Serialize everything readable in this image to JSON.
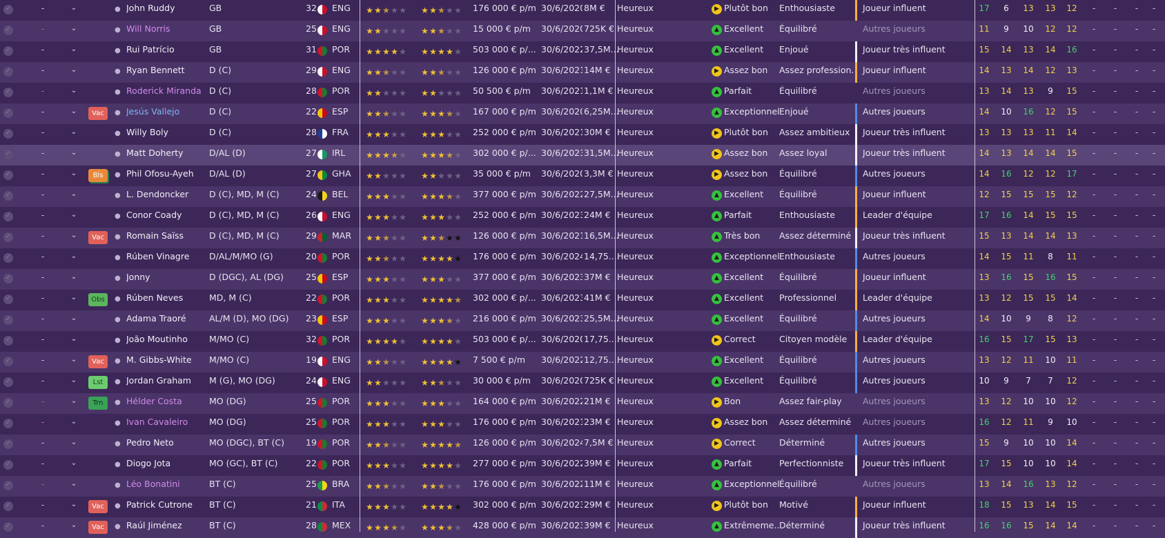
{
  "colors": {
    "positive": "#35c13e",
    "warning": "#f0c419",
    "loan": "#d28be9"
  },
  "rows": [
    {
      "name": "John Ruddy",
      "pos": "GB",
      "age": "32",
      "nat": "ENG",
      "cur": "2.5",
      "pot": "2.5",
      "wage": "176 000 € p/m",
      "exp": "30/6/2020",
      "val": "8M €",
      "happy": "Heureux",
      "cond_icon": "yellow",
      "cond": "Plutôt bon",
      "pers": "Enthousiaste",
      "status": "Joueur influent",
      "status_color": "yellow",
      "attrs": [
        "17",
        "6",
        "13",
        "13",
        "12"
      ]
    },
    {
      "name": "Will Norris",
      "pos": "GB",
      "age": "25",
      "nat": "ENG",
      "cur": "2",
      "pot": "2.5",
      "wage": "15 000 € p/m",
      "exp": "30/6/2020",
      "val": "725K €",
      "happy": "Heureux",
      "cond_icon": "green",
      "cond": "Excellent",
      "pers": "Équilibré",
      "status": "Autres joueurs",
      "status_color": "none",
      "attrs": [
        "11",
        "9",
        "10",
        "12",
        "12"
      ]
    },
    {
      "name": "Rui Patrício",
      "pos": "GB",
      "age": "31",
      "nat": "POR",
      "cur": "4",
      "pot": "4",
      "wage": "503 000 € p/...",
      "exp": "30/6/2022",
      "val": "37,5M...",
      "happy": "Heureux",
      "cond_icon": "green",
      "cond": "Excellent",
      "pers": "Enjoué",
      "status": "Joueur très influent",
      "status_color": "white",
      "attrs": [
        "15",
        "14",
        "13",
        "14",
        "16"
      ]
    },
    {
      "name": "Ryan Bennett",
      "pos": "D (C)",
      "age": "29",
      "nat": "ENG",
      "cur": "2.5",
      "pot": "2.5",
      "wage": "126 000 € p/m",
      "exp": "30/6/2021",
      "val": "14M €",
      "happy": "Heureux",
      "cond_icon": "yellow",
      "cond": "Assez bon",
      "pers": "Assez profession...",
      "status": "Joueur influent",
      "status_color": "yellow",
      "attrs": [
        "14",
        "13",
        "14",
        "12",
        "13"
      ]
    },
    {
      "name": "Roderick Miranda",
      "pos": "D (C)",
      "age": "28",
      "nat": "POR",
      "cur": "2",
      "pot": "2",
      "wage": "50 500 € p/m",
      "exp": "30/6/2021",
      "val": "1,1M €",
      "happy": "Heureux",
      "cond_icon": "green",
      "cond": "Parfait",
      "pers": "Équilibré",
      "status": "Autres joueurs",
      "status_color": "none",
      "attrs": [
        "13",
        "14",
        "13",
        "9",
        "15"
      ]
    },
    {
      "name": "Jesús Vallejo",
      "pos": "D (C)",
      "age": "22",
      "nat": "ESP",
      "cur": "2.5",
      "pot": "3.5",
      "wage": "167 000 € p/m",
      "exp": "30/6/2020",
      "val": "6,25M...",
      "happy": "Heureux",
      "cond_icon": "green",
      "cond": "Exceptionnel",
      "pers": "Enjoué",
      "status": "Autres joueurs",
      "status_color": "blue",
      "attrs": [
        "14",
        "10",
        "16",
        "12",
        "15"
      ]
    },
    {
      "name": "Willy Boly",
      "pos": "D (C)",
      "age": "28",
      "nat": "FRA",
      "cur": "3",
      "pot": "3",
      "wage": "252 000 € p/m",
      "exp": "30/6/2021",
      "val": "30M €",
      "happy": "Heureux",
      "cond_icon": "yellow",
      "cond": "Plutôt bon",
      "pers": "Assez ambitieux",
      "status": "Joueur très influent",
      "status_color": "white",
      "attrs": [
        "13",
        "13",
        "13",
        "11",
        "14"
      ]
    },
    {
      "name": "Matt Doherty",
      "pos": "D/AL (D)",
      "age": "27",
      "nat": "IRL",
      "cur": "3.5",
      "pot": "3.5",
      "wage": "302 000 € p/...",
      "exp": "30/6/2023",
      "val": "31,5M...",
      "happy": "Heureux",
      "cond_icon": "yellow",
      "cond": "Assez bon",
      "pers": "Assez loyal",
      "status": "Joueur très influent",
      "status_color": "white",
      "attrs": [
        "14",
        "13",
        "14",
        "14",
        "15"
      ]
    },
    {
      "name": "Phil Ofosu-Ayeh",
      "pos": "D/AL (D)",
      "age": "27",
      "nat": "GHA",
      "cur": "2",
      "pot": "2",
      "wage": "35 000 € p/m",
      "exp": "30/6/2020",
      "val": "3,3M €",
      "happy": "Heureux",
      "cond_icon": "yellow",
      "cond": "Assez bon",
      "pers": "Équilibré",
      "status": "Autres joueurs",
      "status_color": "blue",
      "attrs": [
        "14",
        "16",
        "12",
        "12",
        "17"
      ]
    },
    {
      "name": "L. Dendoncker",
      "pos": "D (C), MD, M (C)",
      "age": "24",
      "nat": "BEL",
      "cur": "3",
      "pot": "3.5",
      "wage": "377 000 € p/m",
      "exp": "30/6/2022",
      "val": "27,5M...",
      "happy": "Heureux",
      "cond_icon": "green",
      "cond": "Excellent",
      "pers": "Équilibré",
      "status": "Joueur influent",
      "status_color": "yellow",
      "attrs": [
        "12",
        "15",
        "15",
        "15",
        "12"
      ]
    },
    {
      "name": "Conor Coady",
      "pos": "D (C), MD, M (C)",
      "age": "26",
      "nat": "ENG",
      "cur": "3",
      "pot": "3",
      "wage": "252 000 € p/m",
      "exp": "30/6/2023",
      "val": "24M €",
      "happy": "Heureux",
      "cond_icon": "green",
      "cond": "Parfait",
      "pers": "Enthousiaste",
      "status": "Leader d'équipe",
      "status_color": "yellow",
      "attrs": [
        "17",
        "16",
        "14",
        "15",
        "15"
      ]
    },
    {
      "name": "Romain Saïss",
      "pos": "D (C), MD, M (C)",
      "age": "29",
      "nat": "MAR",
      "cur": "2.5",
      "pot": "2.5",
      "wage": "126 000 € p/m",
      "exp": "30/6/2021",
      "val": "16,5M...",
      "happy": "Heureux",
      "cond_icon": "green",
      "cond": "Très bon",
      "pers": "Assez déterminé",
      "status": "Joueur très influent",
      "status_color": "white",
      "attrs": [
        "15",
        "13",
        "14",
        "14",
        "13"
      ]
    },
    {
      "name": "Rúben Vinagre",
      "pos": "D/AL/M/MO (G)",
      "age": "20",
      "nat": "POR",
      "cur": "2.5",
      "pot": "4",
      "wage": "176 000 € p/m",
      "exp": "30/6/2024",
      "val": "14,75....",
      "happy": "Heureux",
      "cond_icon": "green",
      "cond": "Exceptionnel",
      "pers": "Enthousiaste",
      "status": "Autres joueurs",
      "status_color": "blue",
      "attrs": [
        "14",
        "15",
        "11",
        "8",
        "11"
      ]
    },
    {
      "name": "Jonny",
      "pos": "D (DGC), AL (DG)",
      "age": "25",
      "nat": "ESP",
      "cur": "3",
      "pot": "3",
      "wage": "377 000 € p/m",
      "exp": "30/6/2023",
      "val": "37M €",
      "happy": "Heureux",
      "cond_icon": "green",
      "cond": "Excellent",
      "pers": "Équilibré",
      "status": "Joueur influent",
      "status_color": "yellow",
      "attrs": [
        "13",
        "16",
        "15",
        "16",
        "15"
      ]
    },
    {
      "name": "Rúben Neves",
      "pos": "MD, M (C)",
      "age": "22",
      "nat": "POR",
      "cur": "3",
      "pot": "4.5",
      "wage": "302 000 € p/...",
      "exp": "30/6/2023",
      "val": "41M €",
      "happy": "Heureux",
      "cond_icon": "green",
      "cond": "Excellent",
      "pers": "Professionnel",
      "status": "Leader d'équipe",
      "status_color": "yellow",
      "attrs": [
        "13",
        "12",
        "15",
        "15",
        "14"
      ]
    },
    {
      "name": "Adama Traoré",
      "pos": "AL/M (D), MO (DG)",
      "age": "23",
      "nat": "ESP",
      "cur": "3",
      "pot": "3.5",
      "wage": "216 000 € p/m",
      "exp": "30/6/2023",
      "val": "25,5M...",
      "happy": "Heureux",
      "cond_icon": "green",
      "cond": "Excellent",
      "pers": "Équilibré",
      "status": "Autres joueurs",
      "status_color": "blue",
      "attrs": [
        "14",
        "10",
        "9",
        "8",
        "12"
      ]
    },
    {
      "name": "João Moutinho",
      "pos": "M/MO (C)",
      "age": "32",
      "nat": "POR",
      "cur": "4",
      "pot": "4",
      "wage": "503 000 € p/...",
      "exp": "30/6/2020",
      "val": "17,75....",
      "happy": "Heureux",
      "cond_icon": "yellow",
      "cond": "Correct",
      "pers": "Citoyen modèle",
      "status": "Leader d'équipe",
      "status_color": "yellow",
      "attrs": [
        "16",
        "15",
        "17",
        "15",
        "13"
      ]
    },
    {
      "name": "M. Gibbs-White",
      "pos": "M/MO (C)",
      "age": "19",
      "nat": "ENG",
      "cur": "2.5",
      "pot": "4",
      "wage": "7 500 € p/m",
      "exp": "30/6/2022",
      "val": "12,75....",
      "happy": "Heureux",
      "cond_icon": "green",
      "cond": "Excellent",
      "pers": "Équilibré",
      "status": "Autres joueurs",
      "status_color": "blue",
      "attrs": [
        "13",
        "12",
        "11",
        "10",
        "11"
      ]
    },
    {
      "name": "Jordan Graham",
      "pos": "M (G), MO (DG)",
      "age": "24",
      "nat": "ENG",
      "cur": "2",
      "pot": "2.5",
      "wage": "30 000 € p/m",
      "exp": "30/6/2020",
      "val": "725K €",
      "happy": "Heureux",
      "cond_icon": "green",
      "cond": "Excellent",
      "pers": "Équilibré",
      "status": "Autres joueurs",
      "status_color": "blue",
      "attrs": [
        "10",
        "9",
        "7",
        "7",
        "12"
      ]
    },
    {
      "name": "Hélder Costa",
      "pos": "MO (DG)",
      "age": "25",
      "nat": "POR",
      "cur": "3",
      "pot": "3",
      "wage": "164 000 € p/m",
      "exp": "30/6/2022",
      "val": "21M €",
      "happy": "Heureux",
      "cond_icon": "yellow",
      "cond": "Bon",
      "pers": "Assez fair-play",
      "status": "Autres joueurs",
      "status_color": "none",
      "attrs": [
        "13",
        "12",
        "10",
        "10",
        "12"
      ]
    },
    {
      "name": "Ivan Cavaleiro",
      "pos": "MO (DG)",
      "age": "25",
      "nat": "POR",
      "cur": "3",
      "pot": "3",
      "wage": "176 000 € p/m",
      "exp": "30/6/2021",
      "val": "23M €",
      "happy": "Heureux",
      "cond_icon": "yellow",
      "cond": "Assez bon",
      "pers": "Assez déterminé",
      "status": "Autres joueurs",
      "status_color": "none",
      "attrs": [
        "16",
        "12",
        "11",
        "9",
        "10"
      ]
    },
    {
      "name": "Pedro Neto",
      "pos": "MO (DGC), BT (C)",
      "age": "19",
      "nat": "POR",
      "cur": "2.5",
      "pot": "4.5",
      "wage": "126 000 € p/m",
      "exp": "30/6/2024",
      "val": "7,5M €",
      "happy": "Heureux",
      "cond_icon": "yellow",
      "cond": "Correct",
      "pers": "Déterminé",
      "status": "Autres joueurs",
      "status_color": "blue",
      "attrs": [
        "15",
        "9",
        "10",
        "10",
        "14"
      ]
    },
    {
      "name": "Diogo Jota",
      "pos": "MO (GC), BT (C)",
      "age": "22",
      "nat": "POR",
      "cur": "3",
      "pot": "4",
      "wage": "277 000 € p/m",
      "exp": "30/6/2022",
      "val": "39M €",
      "happy": "Heureux",
      "cond_icon": "green",
      "cond": "Parfait",
      "pers": "Perfectionniste",
      "status": "Joueur très influent",
      "status_color": "white",
      "attrs": [
        "17",
        "15",
        "10",
        "10",
        "14"
      ]
    },
    {
      "name": "Léo Bonatini",
      "pos": "BT (C)",
      "age": "25",
      "nat": "BRA",
      "cur": "2.5",
      "pot": "2.5",
      "wage": "176 000 € p/m",
      "exp": "30/6/2022",
      "val": "11M €",
      "happy": "Heureux",
      "cond_icon": "green",
      "cond": "Exceptionnel",
      "pers": "Équilibré",
      "status": "Autres joueurs",
      "status_color": "none",
      "attrs": [
        "13",
        "14",
        "16",
        "13",
        "12"
      ]
    },
    {
      "name": "Patrick Cutrone",
      "pos": "BT (C)",
      "age": "21",
      "nat": "ITA",
      "cur": "3",
      "pot": "4",
      "wage": "302 000 € p/m",
      "exp": "30/6/2023",
      "val": "29M €",
      "happy": "Heureux",
      "cond_icon": "yellow",
      "cond": "Plutôt bon",
      "pers": "Motivé",
      "status": "Joueur influent",
      "status_color": "yellow",
      "attrs": [
        "18",
        "15",
        "13",
        "14",
        "15"
      ]
    },
    {
      "name": "Raúl Jiménez",
      "pos": "BT (C)",
      "age": "28",
      "nat": "MEX",
      "cur": "3.5",
      "pot": "3.5",
      "wage": "428 000 € p/m",
      "exp": "30/6/2023",
      "val": "39M €",
      "happy": "Heureux",
      "cond_icon": "green",
      "cond": "Extrêmeme...",
      "pers": "Déterminé",
      "status": "Joueur très influent",
      "status_color": "white",
      "attrs": [
        "16",
        "16",
        "15",
        "14",
        "14"
      ]
    }
  ],
  "badges": {
    "5": "Vac",
    "8": "Bls",
    "11": "Vac",
    "14": "Obs",
    "17": "Vac",
    "18": "Lst",
    "19": "Trn",
    "24": "Vac",
    "25": "Vac"
  },
  "row_styles": {
    "1": "pink",
    "4": "pink",
    "5": "blue",
    "19": "pink",
    "20": "pink",
    "23": "pink"
  },
  "dash_red_rows": [
    "1",
    "4",
    "19",
    "20",
    "23"
  ],
  "attr_colors": {
    "0": [
      "green",
      "white",
      "yellow",
      "yellow",
      "yellow"
    ],
    "1": [
      "yellow",
      "white",
      "white",
      "yellow",
      "yellow"
    ],
    "2": [
      "yellow",
      "yellow",
      "yellow",
      "yellow",
      "green"
    ],
    "3": [
      "yellow",
      "yellow",
      "yellow",
      "yellow",
      "yellow"
    ],
    "4": [
      "yellow",
      "yellow",
      "yellow",
      "white",
      "yellow"
    ],
    "5": [
      "yellow",
      "white",
      "green",
      "yellow",
      "yellow"
    ],
    "6": [
      "yellow",
      "yellow",
      "yellow",
      "yellow",
      "yellow"
    ],
    "7": [
      "yellow",
      "yellow",
      "yellow",
      "yellow",
      "yellow"
    ],
    "8": [
      "yellow",
      "green",
      "yellow",
      "yellow",
      "green"
    ],
    "9": [
      "yellow",
      "yellow",
      "yellow",
      "yellow",
      "yellow"
    ],
    "10": [
      "green",
      "green",
      "yellow",
      "yellow",
      "yellow"
    ],
    "11": [
      "yellow",
      "yellow",
      "yellow",
      "yellow",
      "yellow"
    ],
    "12": [
      "yellow",
      "yellow",
      "yellow",
      "white",
      "yellow"
    ],
    "13": [
      "yellow",
      "green",
      "yellow",
      "green",
      "yellow"
    ],
    "14": [
      "yellow",
      "yellow",
      "yellow",
      "yellow",
      "yellow"
    ],
    "15": [
      "yellow",
      "white",
      "white",
      "white",
      "yellow"
    ],
    "16": [
      "green",
      "yellow",
      "green",
      "yellow",
      "yellow"
    ],
    "17": [
      "yellow",
      "yellow",
      "yellow",
      "white",
      "yellow"
    ],
    "18": [
      "white",
      "white",
      "white",
      "white",
      "yellow"
    ],
    "19": [
      "yellow",
      "yellow",
      "white",
      "white",
      "yellow"
    ],
    "20": [
      "green",
      "yellow",
      "yellow",
      "white",
      "white"
    ],
    "21": [
      "yellow",
      "white",
      "white",
      "white",
      "yellow"
    ],
    "22": [
      "green",
      "yellow",
      "white",
      "white",
      "yellow"
    ],
    "23": [
      "yellow",
      "yellow",
      "green",
      "yellow",
      "yellow"
    ],
    "24": [
      "green",
      "yellow",
      "yellow",
      "yellow",
      "yellow"
    ],
    "25": [
      "green",
      "green",
      "yellow",
      "yellow",
      "yellow"
    ]
  },
  "trailing_dash": "-"
}
